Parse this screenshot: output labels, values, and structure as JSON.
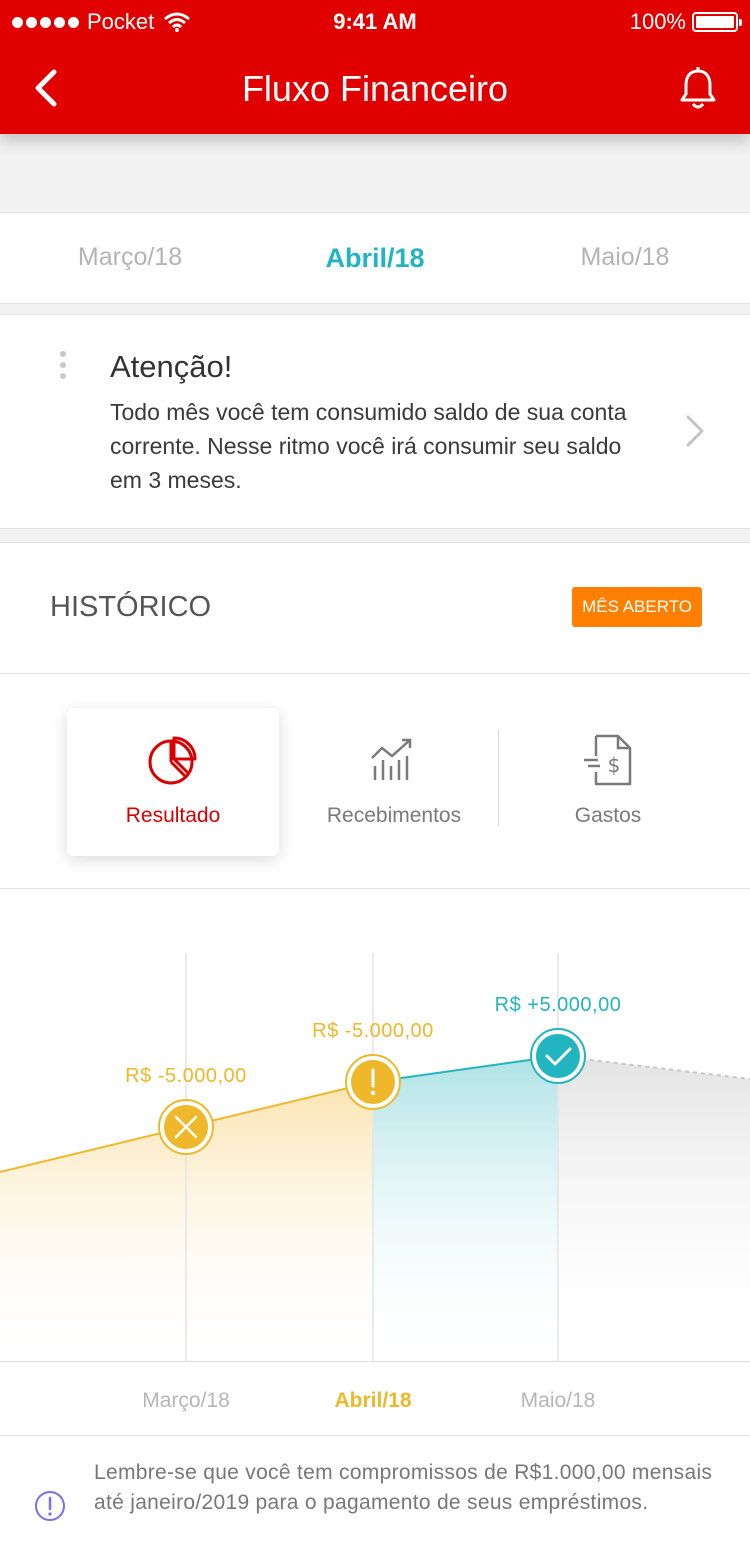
{
  "status_bar": {
    "carrier": "Pocket",
    "time": "9:41 AM",
    "battery": "100%"
  },
  "header": {
    "title": "Fluxo Financeiro",
    "brand_color": "#e00000"
  },
  "months": {
    "prev": "Março/18",
    "current": "Abril/18",
    "next": "Maio/18"
  },
  "alert": {
    "title": "Atenção!",
    "message": "Todo mês você tem consumido saldo de sua conta corrente. Nesse ritmo você irá consumir seu saldo em 3 meses."
  },
  "historico": {
    "title": "HISTÓRICO",
    "badge": "MÊS ABERTO"
  },
  "tabs": [
    {
      "label": "Resultado",
      "icon": "pie-chart-icon",
      "active": true
    },
    {
      "label": "Recebimentos",
      "icon": "trending-up-icon",
      "active": false
    },
    {
      "label": "Gastos",
      "icon": "expense-document-icon",
      "active": false
    }
  ],
  "chart_data": {
    "type": "area",
    "categories": [
      "Março/18",
      "Abril/18",
      "Maio/18"
    ],
    "values": [
      -5000,
      -5000,
      5000
    ],
    "labels": [
      "R$ -5.000,00",
      "R$ -5.000,00",
      "R$ +5.000,00"
    ],
    "status": [
      "error",
      "warning",
      "success"
    ],
    "colors": {
      "error": "#efb72a",
      "warning": "#efb72a",
      "success": "#22b5bf",
      "future": "#d5d5d5"
    },
    "highlighted": "Abril/18"
  },
  "footer": {
    "message": "Lembre-se que você tem compromissos de R$1.000,00 mensais até janeiro/2019 para o pagamento de seus empréstimos."
  }
}
